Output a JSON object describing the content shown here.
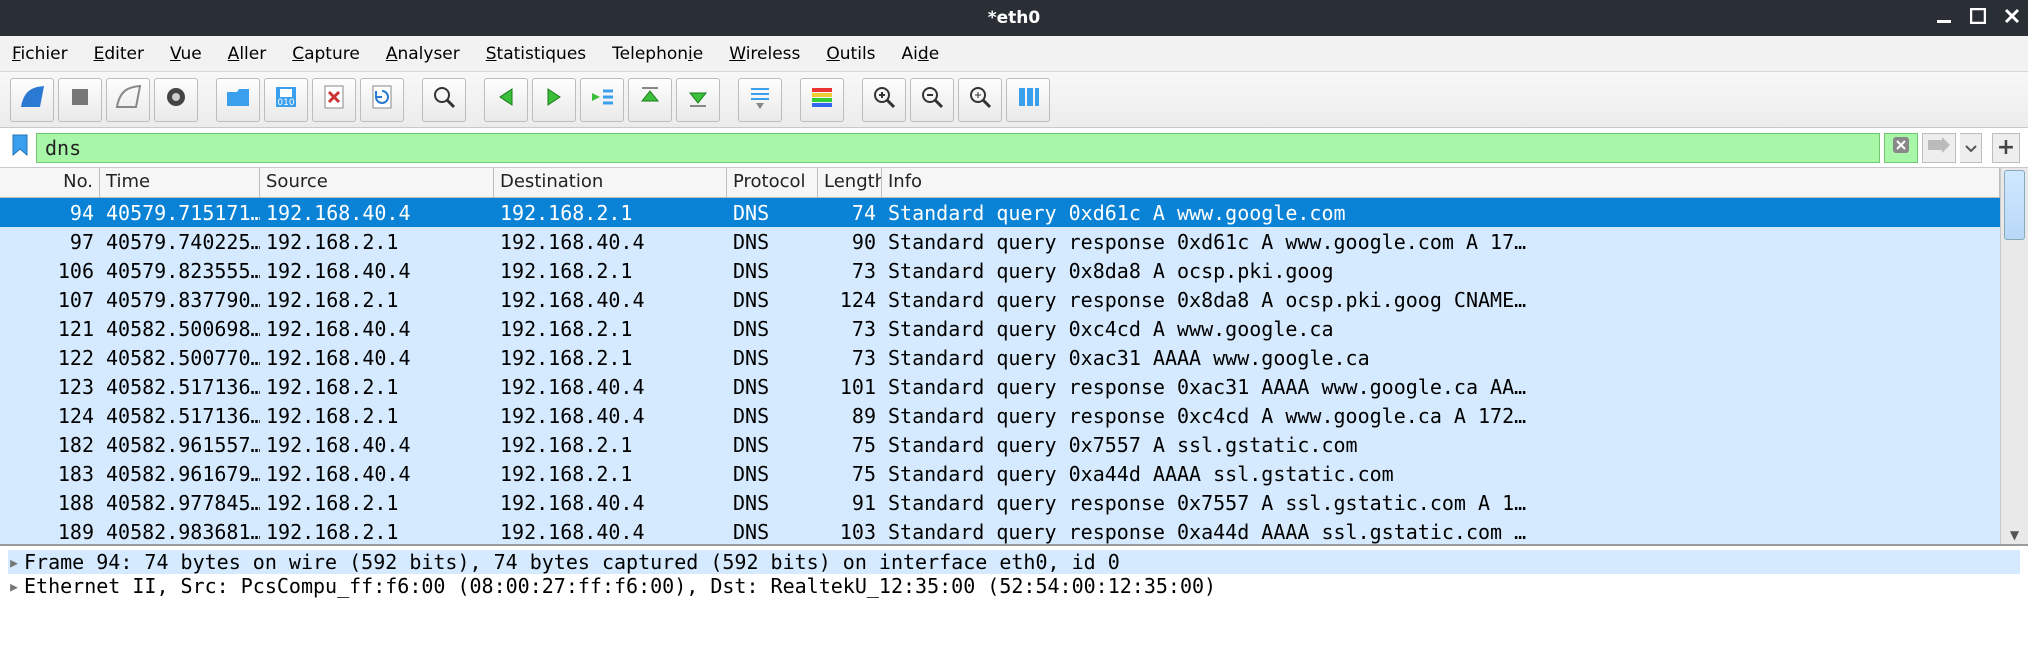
{
  "window": {
    "title": "*eth0"
  },
  "menu": {
    "file": {
      "label": "Fichier",
      "ul": "F",
      "rest": "ichier"
    },
    "edit": {
      "label": "Editer",
      "ul": "E",
      "rest": "diter"
    },
    "view": {
      "label": "Vue",
      "ul": "V",
      "rest": "ue"
    },
    "go": {
      "label": "Aller",
      "ul": "A",
      "rest": "ller"
    },
    "capture": {
      "label": "Capture",
      "ul": "C",
      "rest": "apture"
    },
    "analyse": {
      "label": "Analyser",
      "ul": "A",
      "rest": "nalyser"
    },
    "stats": {
      "label": "Statistiques",
      "ul": "S",
      "rest": "tatistiques"
    },
    "tel": {
      "label": "Telephonie",
      "ul": "",
      "p1": "Telephon",
      "u": "i",
      "p2": "e"
    },
    "wireless": {
      "label": "Wireless",
      "ul": "W",
      "rest": "ireless"
    },
    "tools": {
      "label": "Outils",
      "ul": "O",
      "rest": "utils"
    },
    "help": {
      "label": "Aide",
      "p1": "Ai",
      "u": "d",
      "p2": "e"
    }
  },
  "filter": {
    "value": "dns",
    "plus": "+"
  },
  "columns": {
    "no": "No.",
    "time": "Time",
    "source": "Source",
    "destination": "Destination",
    "protocol": "Protocol",
    "length": "Length",
    "info": "Info"
  },
  "packets": [
    {
      "no": "94",
      "time": "40579.715171…",
      "src": "192.168.40.4",
      "dst": "192.168.2.1",
      "prot": "DNS",
      "len": "74",
      "info": "Standard query 0xd61c A www.google.com",
      "selected": true
    },
    {
      "no": "97",
      "time": "40579.740225…",
      "src": "192.168.2.1",
      "dst": "192.168.40.4",
      "prot": "DNS",
      "len": "90",
      "info": "Standard query response 0xd61c A www.google.com A 17…"
    },
    {
      "no": "106",
      "time": "40579.823555…",
      "src": "192.168.40.4",
      "dst": "192.168.2.1",
      "prot": "DNS",
      "len": "73",
      "info": "Standard query 0x8da8 A ocsp.pki.goog"
    },
    {
      "no": "107",
      "time": "40579.837790…",
      "src": "192.168.2.1",
      "dst": "192.168.40.4",
      "prot": "DNS",
      "len": "124",
      "info": "Standard query response 0x8da8 A ocsp.pki.goog CNAME…"
    },
    {
      "no": "121",
      "time": "40582.500698…",
      "src": "192.168.40.4",
      "dst": "192.168.2.1",
      "prot": "DNS",
      "len": "73",
      "info": "Standard query 0xc4cd A www.google.ca"
    },
    {
      "no": "122",
      "time": "40582.500770…",
      "src": "192.168.40.4",
      "dst": "192.168.2.1",
      "prot": "DNS",
      "len": "73",
      "info": "Standard query 0xac31 AAAA www.google.ca"
    },
    {
      "no": "123",
      "time": "40582.517136…",
      "src": "192.168.2.1",
      "dst": "192.168.40.4",
      "prot": "DNS",
      "len": "101",
      "info": "Standard query response 0xac31 AAAA www.google.ca AA…"
    },
    {
      "no": "124",
      "time": "40582.517136…",
      "src": "192.168.2.1",
      "dst": "192.168.40.4",
      "prot": "DNS",
      "len": "89",
      "info": "Standard query response 0xc4cd A www.google.ca A 172…"
    },
    {
      "no": "182",
      "time": "40582.961557…",
      "src": "192.168.40.4",
      "dst": "192.168.2.1",
      "prot": "DNS",
      "len": "75",
      "info": "Standard query 0x7557 A ssl.gstatic.com"
    },
    {
      "no": "183",
      "time": "40582.961679…",
      "src": "192.168.40.4",
      "dst": "192.168.2.1",
      "prot": "DNS",
      "len": "75",
      "info": "Standard query 0xa44d AAAA ssl.gstatic.com"
    },
    {
      "no": "188",
      "time": "40582.977845…",
      "src": "192.168.2.1",
      "dst": "192.168.40.4",
      "prot": "DNS",
      "len": "91",
      "info": "Standard query response 0x7557 A ssl.gstatic.com A 1…"
    },
    {
      "no": "189",
      "time": "40582.983681…",
      "src": "192.168.2.1",
      "dst": "192.168.40.4",
      "prot": "DNS",
      "len": "103",
      "info": "Standard query response 0xa44d AAAA ssl.gstatic.com …"
    }
  ],
  "details": {
    "line0": "Frame 94: 74 bytes on wire (592 bits), 74 bytes captured (592 bits) on interface eth0, id 0",
    "line1": "Ethernet II, Src: PcsCompu_ff:f6:00 (08:00:27:ff:f6:00), Dst: RealtekU_12:35:00 (52:54:00:12:35:00)"
  }
}
